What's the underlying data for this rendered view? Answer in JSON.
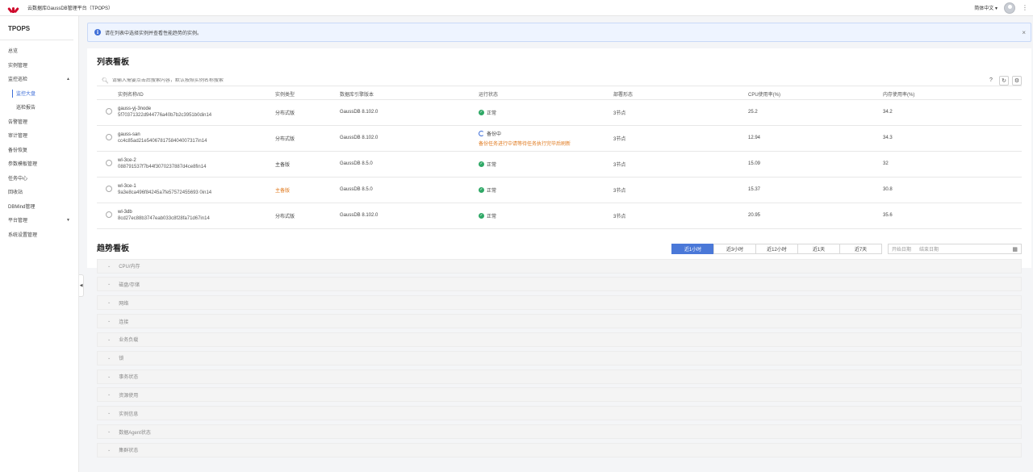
{
  "topbar": {
    "app_title": "云数据库GaussDB管理平台（TPOPS）",
    "language": "简体中文",
    "user": "avatar"
  },
  "sidebar": {
    "brand": "TPOPS",
    "items": [
      {
        "label": "总览"
      },
      {
        "label": "实例管理"
      },
      {
        "label": "监控巡检",
        "expanded": true
      },
      {
        "label": "监控大盘",
        "sub": true,
        "active": true
      },
      {
        "label": "巡检报告",
        "sub": true
      },
      {
        "label": "告警管理"
      },
      {
        "label": "审计管理"
      },
      {
        "label": "备份恢复"
      },
      {
        "label": "参数模板管理"
      },
      {
        "label": "任务中心"
      },
      {
        "label": "回收站"
      },
      {
        "label": "DBMind管理"
      },
      {
        "label": "平台管理",
        "collapsed": true
      },
      {
        "label": "系统设置管理"
      }
    ]
  },
  "notice": {
    "text": "请在列表中选择实例并查看性能趋势的实例。"
  },
  "list_panel": {
    "title": "列表看板",
    "search_placeholder": "请输入需要点击后搜索内容，默认按照实例名称搜索",
    "columns": [
      "实例名称/ID",
      "实例类型",
      "数据库引擎版本",
      "运行状态",
      "部署形态",
      "CPU使用率(%)",
      "内存使用率(%)"
    ],
    "rows": [
      {
        "name": "gauss-yj-3node",
        "id": "5f70371322d944776a40b7b2c3951b0din14",
        "type": "分布式版",
        "engine": "GaussDB 8.102.0",
        "status": "正常",
        "status_kind": "ok",
        "status_note": "",
        "deploy": "3节点",
        "cpu": "25.2",
        "mem": "34.2"
      },
      {
        "name": "gauss-san",
        "id": "cc4c85ad21e5406781758404007317in14",
        "type": "分布式版",
        "engine": "GaussDB 8.102.0",
        "status": "备份中",
        "status_kind": "busy",
        "status_note": "备份任务进行中请等待任务执行完毕后刷新",
        "deploy": "3节点",
        "cpu": "12.94",
        "mem": "34.3"
      },
      {
        "name": "wl-3ce-2",
        "id": "088791537f7b44f3070237887d4ce8fin14",
        "type": "主备版",
        "engine": "GaussDB 8.5.0",
        "status": "正常",
        "status_kind": "ok",
        "status_note": "",
        "deploy": "3节点",
        "cpu": "15.09",
        "mem": "32"
      },
      {
        "name": "wl-3ce-1",
        "id": "9a3e8ca496f84245a7fe57572455693 0in14",
        "type": "主备版",
        "engine": "GaussDB 8.5.0",
        "status": "正常",
        "status_kind": "ok",
        "status_note": "",
        "deploy": "3节点",
        "cpu": "15.37",
        "mem": "30.8"
      },
      {
        "name": "wl-3db",
        "id": "8cd27ec88b3747eab033c8f28fa71d67in14",
        "type": "分布式版",
        "engine": "GaussDB 8.102.0",
        "status": "正常",
        "status_kind": "ok",
        "status_note": "",
        "deploy": "3节点",
        "cpu": "20.95",
        "mem": "35.6"
      }
    ]
  },
  "trend_panel": {
    "title": "趋势看板",
    "ranges": [
      "近1小时",
      "近3小时",
      "近12小时",
      "近1天",
      "近7天"
    ],
    "active_range": 0,
    "date_start_placeholder": "开始日期",
    "date_end_placeholder": "结束日期",
    "sections": [
      "CPU/内存",
      "磁盘/存储",
      "网络",
      "连接",
      "业务负载",
      "锁",
      "事务状态",
      "资源使用",
      "实例信息",
      "数据Agent状态",
      "集群状态"
    ]
  },
  "colors": {
    "accent": "#4a78d8",
    "ok": "#2fa866",
    "warn": "#e07a1f",
    "brand": "#cf0a2c"
  }
}
